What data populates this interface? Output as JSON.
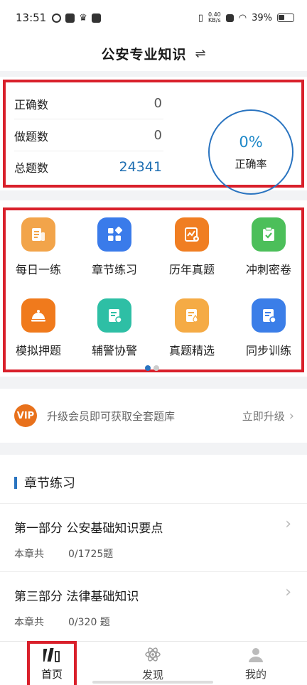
{
  "status_bar": {
    "time": "13:51",
    "net_speed_value": "0.40",
    "net_speed_unit": "KB/s",
    "battery": "39%"
  },
  "header": {
    "title": "公安专业知识",
    "swap_icon": "⇌"
  },
  "stats": {
    "correct_label": "正确数",
    "correct_value": "0",
    "done_label": "做题数",
    "done_value": "0",
    "total_label": "总题数",
    "total_value": "24341",
    "rate_value": "0%",
    "rate_label": "正确率"
  },
  "grid": {
    "items": [
      {
        "label": "每日一练",
        "icon": "newspaper-icon",
        "color": "#f2a44a"
      },
      {
        "label": "章节练习",
        "icon": "blocks-icon",
        "color": "#3a7bea"
      },
      {
        "label": "历年真题",
        "icon": "chart-icon",
        "color": "#f07e22"
      },
      {
        "label": "冲刺密卷",
        "icon": "clipboard-check-icon",
        "color": "#4cbf5a"
      },
      {
        "label": "模拟押题",
        "icon": "cloche-icon",
        "color": "#f07a1c"
      },
      {
        "label": "辅警协警",
        "icon": "document-icon",
        "color": "#2ebfa5"
      },
      {
        "label": "真题精选",
        "icon": "document-drop-icon",
        "color": "#f5ab45"
      },
      {
        "label": "同步训练",
        "icon": "document-icon",
        "color": "#3b7ee8"
      }
    ]
  },
  "vip": {
    "badge": "VIP",
    "text": "升级会员即可获取全套题库",
    "link": "立即升级"
  },
  "chapters": {
    "section_title": "章节练习",
    "items": [
      {
        "title": "第一部分 公安基础知识要点",
        "meta_label": "本章共",
        "meta_value": "0/1725题"
      },
      {
        "title": "第三部分 法律基础知识",
        "meta_label": "本章共",
        "meta_value": "0/320 题"
      }
    ]
  },
  "tabs": {
    "home": "首页",
    "discover": "发现",
    "mine": "我的"
  }
}
